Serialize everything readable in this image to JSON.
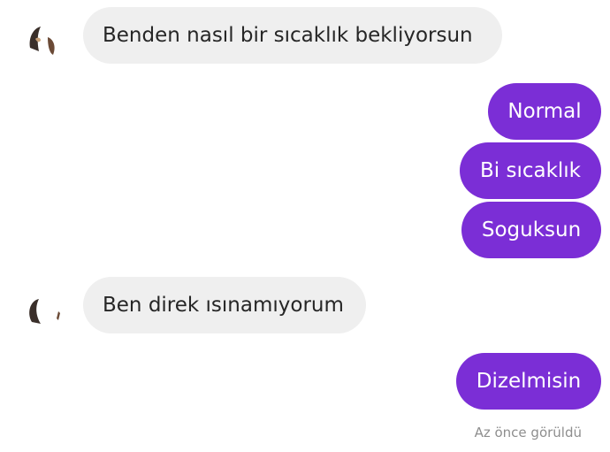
{
  "colors": {
    "outgoing_bubble": "#7b2ed6",
    "incoming_bubble": "#efefef",
    "incoming_text": "#262626",
    "outgoing_text": "#ffffff",
    "seen_text": "#8e8e8e"
  },
  "messages": [
    {
      "direction": "incoming",
      "text": "Benden nasıl bir sıcaklık bekliyorsun"
    },
    {
      "direction": "outgoing",
      "text": "Normal"
    },
    {
      "direction": "outgoing",
      "text": "Bi sıcaklık"
    },
    {
      "direction": "outgoing",
      "text": "Soguksun"
    },
    {
      "direction": "incoming",
      "text": "Ben direk ısınamıyorum"
    },
    {
      "direction": "outgoing",
      "text": "Dizelmisin"
    }
  ],
  "status": {
    "seen_label": "Az önce görüldü"
  }
}
